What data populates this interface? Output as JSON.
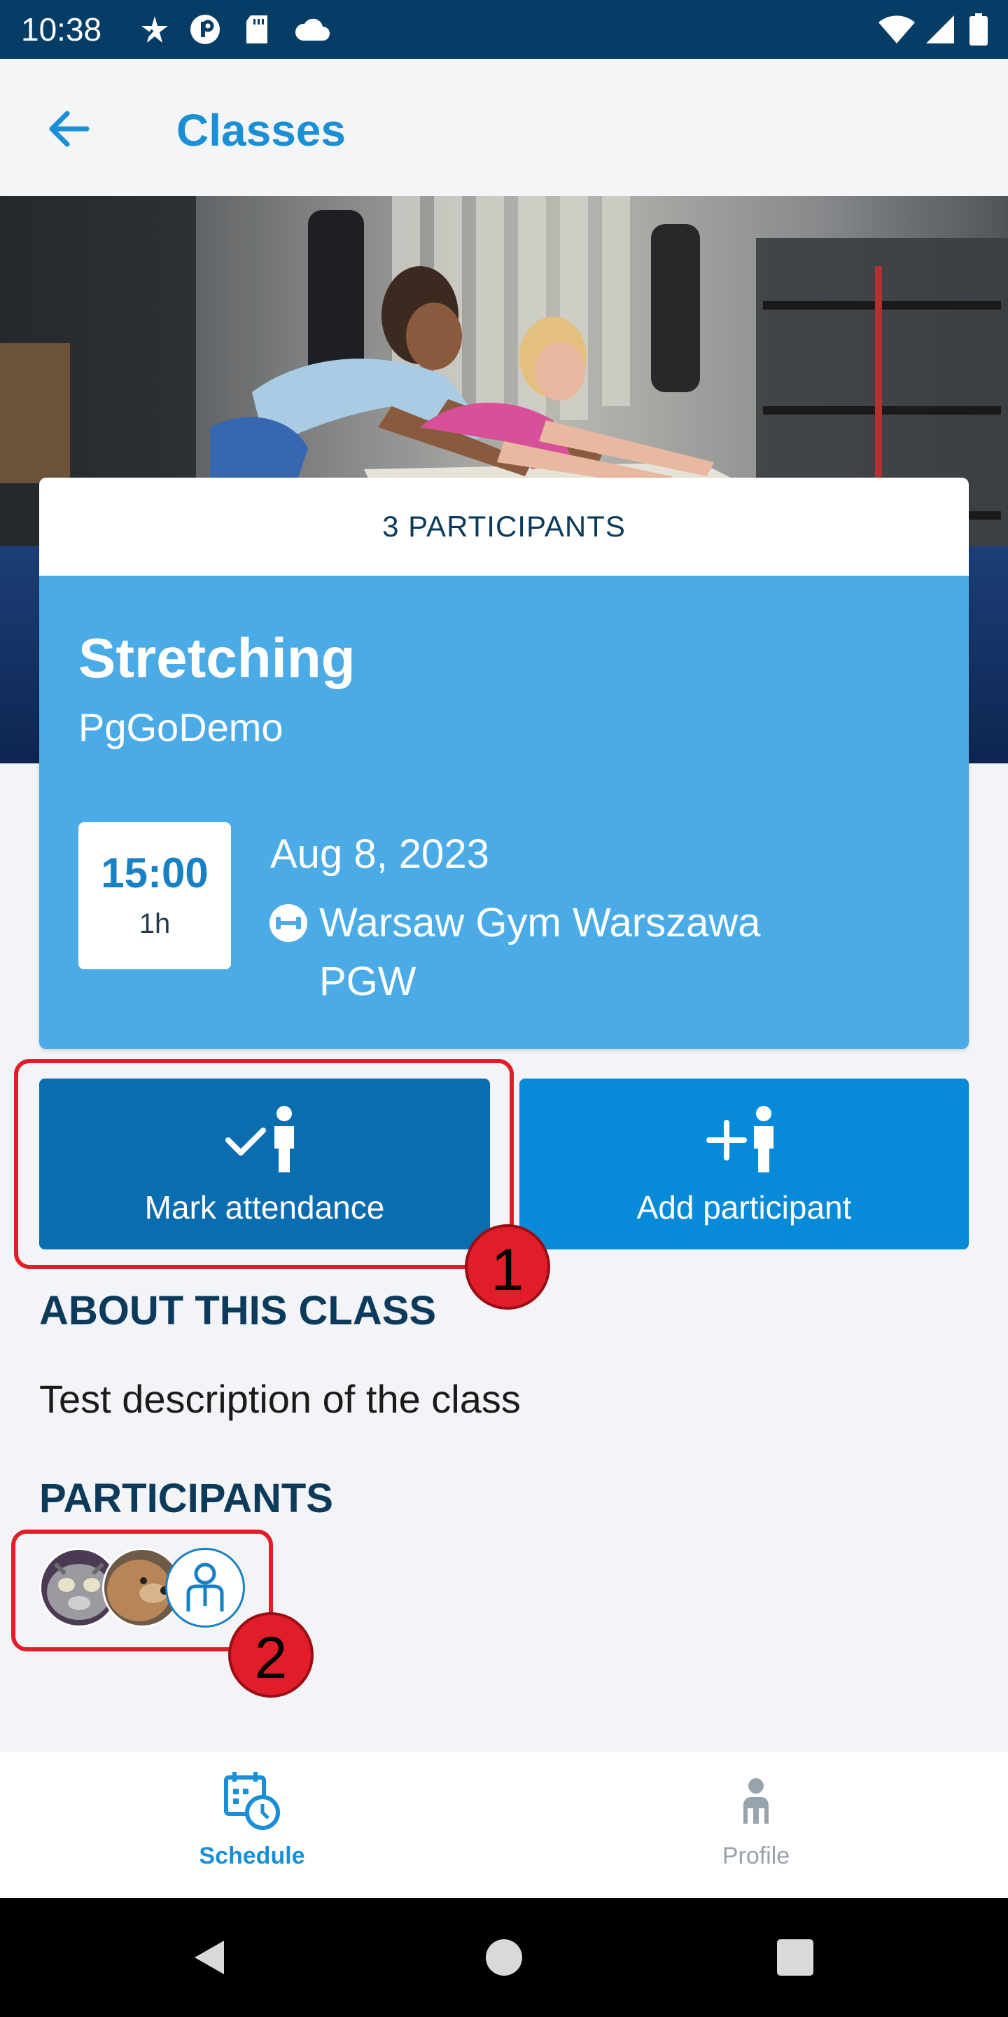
{
  "status_bar": {
    "time": "10:38"
  },
  "app_bar": {
    "back_icon": "arrow-left-icon",
    "title": "Classes"
  },
  "card": {
    "participants_count": "3 PARTICIPANTS",
    "class_name": "Stretching",
    "organization": "PgGoDemo",
    "time": "15:00",
    "duration": "1h",
    "date": "Aug 8, 2023",
    "location_icon": "dumbbell-icon",
    "location": "Warsaw Gym Warszawa PGW"
  },
  "actions": {
    "mark_attendance_label": "Mark attendance",
    "add_participant_label": "Add participant"
  },
  "annotations": {
    "marker_1": "1",
    "marker_2": "2"
  },
  "about": {
    "heading": "ABOUT THIS CLASS",
    "description": "Test description of the class"
  },
  "participants": {
    "heading": "PARTICIPANTS",
    "avatars": [
      "cat-avatar",
      "dog-avatar",
      "default-person-avatar"
    ]
  },
  "bottom_nav": {
    "schedule_label": "Schedule",
    "profile_label": "Profile"
  },
  "colors": {
    "status_bar": "#053d66",
    "accent": "#1a8fd6",
    "card_blue": "#4aabe6",
    "mark_button": "#0a6db0",
    "add_button": "#078bd8",
    "highlight": "#e21d2a"
  }
}
